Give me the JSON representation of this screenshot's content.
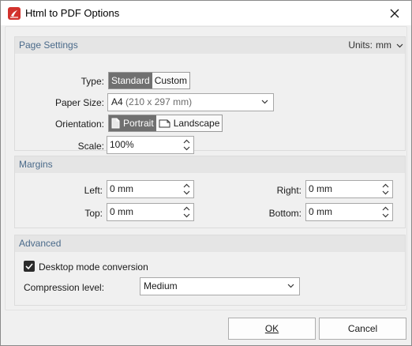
{
  "window": {
    "title": "Html to PDF Options"
  },
  "page_settings": {
    "header": "Page Settings",
    "units_label": "Units:",
    "units_value": "mm",
    "type_label": "Type:",
    "type_options": [
      "Standard",
      "Custom"
    ],
    "type_selected": "Standard",
    "paper_size_label": "Paper Size:",
    "paper_size_value": "A4",
    "paper_size_hint": "(210 x 297 mm)",
    "orientation_label": "Orientation:",
    "orientation_options": [
      "Portrait",
      "Landscape"
    ],
    "orientation_selected": "Portrait",
    "scale_label": "Scale:",
    "scale_value": "100%"
  },
  "margins": {
    "header": "Margins",
    "left_label": "Left:",
    "left_value": "0 mm",
    "right_label": "Right:",
    "right_value": "0 mm",
    "top_label": "Top:",
    "top_value": "0 mm",
    "bottom_label": "Bottom:",
    "bottom_value": "0 mm"
  },
  "advanced": {
    "header": "Advanced",
    "desktop_mode_label": "Desktop mode conversion",
    "desktop_mode_checked": true,
    "compression_label": "Compression level:",
    "compression_value": "Medium"
  },
  "footer": {
    "ok_label": "OK",
    "cancel_label": "Cancel"
  },
  "icons": {
    "app": "pdf-app-icon",
    "close": "close-icon",
    "dropdown": "chevron-down-icon",
    "spinner": "spinner-arrows-icon",
    "portrait": "portrait-page-icon",
    "landscape": "landscape-page-icon",
    "check": "checkmark-icon"
  },
  "colors": {
    "app_icon": "#d2322d",
    "section_header_text": "#4a6a8a",
    "active_segment": "#707070"
  }
}
